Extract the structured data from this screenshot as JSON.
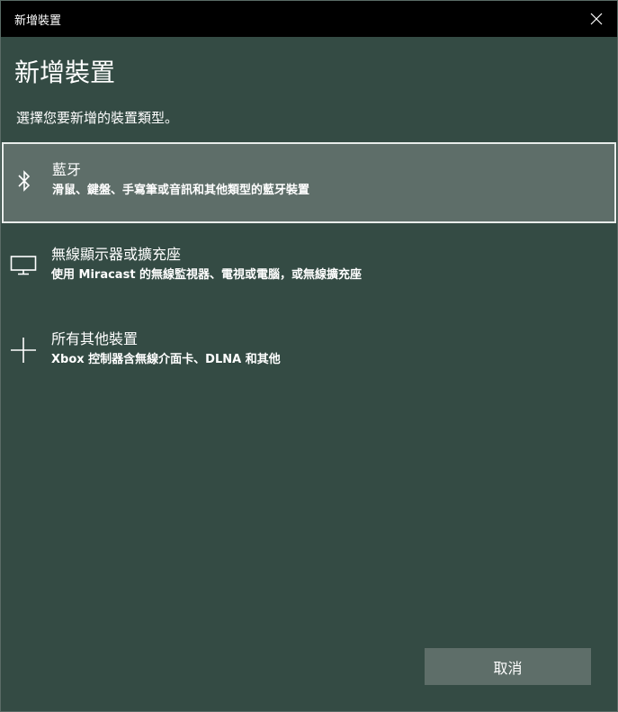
{
  "window": {
    "title": "新增裝置",
    "close_icon": "close-icon"
  },
  "header": {
    "title": "新增裝置",
    "subtitle": "選擇您要新增的裝置類型。"
  },
  "options": [
    {
      "icon": "bluetooth-icon",
      "title": "藍牙",
      "description": "滑鼠、鍵盤、手寫筆或音訊和其他類型的藍牙裝置",
      "selected": true
    },
    {
      "icon": "monitor-icon",
      "title": "無線顯示器或擴充座",
      "description": "使用 Miracast 的無線監視器、電視或電腦，或無線擴充座",
      "selected": false
    },
    {
      "icon": "plus-icon",
      "title": "所有其他裝置",
      "description": "Xbox 控制器含無線介面卡、DLNA 和其他",
      "selected": false
    }
  ],
  "footer": {
    "cancel_label": "取消"
  },
  "colors": {
    "background": "#344b44",
    "titlebar": "#000000",
    "selected_background": "#5e6e69",
    "selected_border": "#e8ecea",
    "button_background": "#5e6e69"
  }
}
